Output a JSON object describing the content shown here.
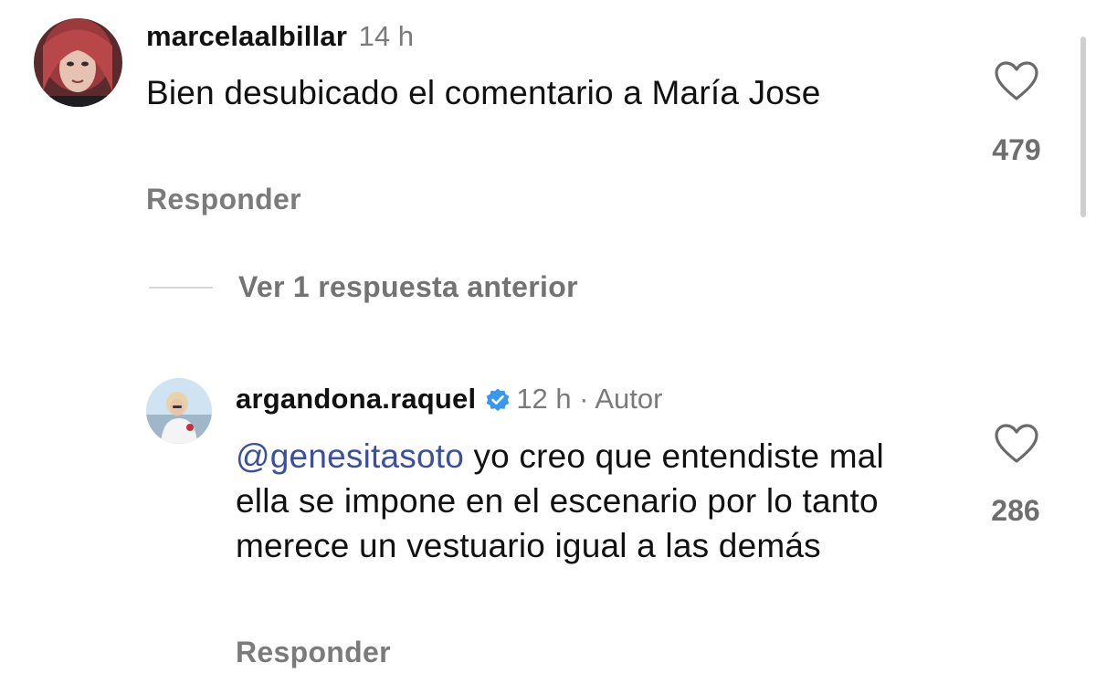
{
  "comments": [
    {
      "username": "marcelaalbillar",
      "time": "14 h",
      "text": "Bien desubicado el comentario a María Jose",
      "reply_label": "Responder",
      "likes": "479",
      "icon": "heart-outline-icon"
    },
    {
      "username": "argandona.raquel",
      "verified": true,
      "time": "12 h",
      "author_tag": "· Autor",
      "mention": "@genesitasoto",
      "text": " yo creo que entendiste mal ella se impone en el escenario por lo tanto merece un vestuario igual a las demás",
      "reply_label": "Responder",
      "likes": "286",
      "icon": "heart-outline-icon"
    }
  ],
  "view_previous_replies": "Ver 1 respuesta anterior",
  "colors": {
    "mention": "#3b4fa0",
    "verified_badge": "#3897f0",
    "muted_text": "#737373"
  }
}
